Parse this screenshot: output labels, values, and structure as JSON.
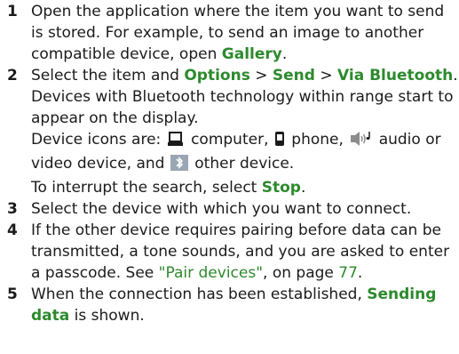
{
  "steps": [
    {
      "num": "1",
      "a": "Open the application where the item you want to send is stored. For example, to send an image to another compatible device, open ",
      "gallery": "Gallery",
      "b": "."
    },
    {
      "num": "2",
      "a": "Select the item and ",
      "options": "Options",
      "sep1": " > ",
      "send": "Send",
      "sep2": " > ",
      "via": "Via Bluetooth",
      "b": ".",
      "c": "Devices with Bluetooth technology within range start to appear on the display.",
      "icons_intro": "Device icons are: ",
      "computer": " computer, ",
      "phone": " phone, ",
      "audio": " audio or video device, and ",
      "other": " other device.",
      "interrupt": "To interrupt the search, select ",
      "stop": "Stop",
      "end": ".",
      "icon_names": [
        "computer-icon",
        "phone-icon",
        "audio-video-icon",
        "bluetooth-icon"
      ]
    },
    {
      "num": "3",
      "a": "Select the device with which you want to connect."
    },
    {
      "num": "4",
      "a": "If the other device requires pairing before data can be transmitted, a tone sounds, and you are asked to enter a passcode. See ",
      "link": "\"Pair devices\"",
      "mid": ", on page ",
      "page": "77",
      "b": "."
    },
    {
      "num": "5",
      "a": "When the connection has been established, ",
      "sending": "Sending data",
      "b": " is shown."
    }
  ],
  "colors": {
    "accent": "#2d8a2d",
    "text": "#1b1b1b"
  }
}
